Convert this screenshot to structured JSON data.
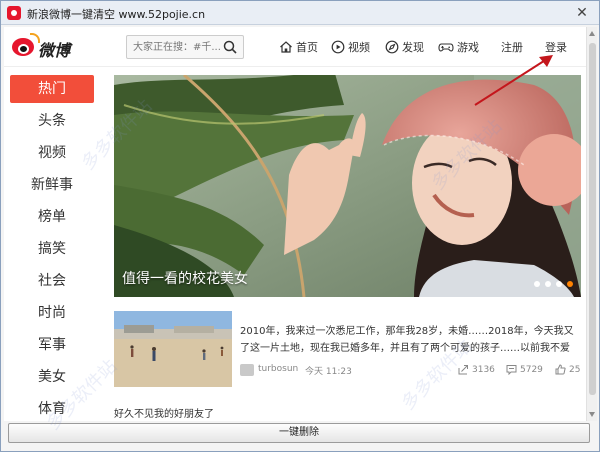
{
  "window": {
    "title": "新浪微博一键清空 www.52pojie.cn",
    "close_symbol": "✕"
  },
  "header": {
    "logo_text": "微博",
    "search_placeholder": "大家正在搜：#千...",
    "nav": {
      "home": "首页",
      "video": "视频",
      "discover": "发现",
      "game": "游戏",
      "register": "注册",
      "login": "登录"
    }
  },
  "sidebar": {
    "items": [
      {
        "label": "热门",
        "active": true
      },
      {
        "label": "头条"
      },
      {
        "label": "视频"
      },
      {
        "label": "新鲜事"
      },
      {
        "label": "榜单"
      },
      {
        "label": "搞笑"
      },
      {
        "label": "社会"
      },
      {
        "label": "时尚"
      },
      {
        "label": "军事"
      },
      {
        "label": "美女"
      },
      {
        "label": "体育"
      }
    ]
  },
  "banner": {
    "caption": "值得一看的校花美女",
    "slide_count": 4,
    "active_slide": 4,
    "colors": {
      "active_dot": "#ff8200"
    }
  },
  "feed": {
    "item": {
      "lines": [
        "2010年，我来过一次悉尼工作，那年我28岁，未婚……2018年，今天我又",
        "了这一片土地，现在我已婚多年，并且有了两个可爱的孩子……以前我不爱"
      ],
      "user": "turbosun",
      "time": "今天 11:23",
      "shares": "3136",
      "comments": "5729",
      "likes": "25"
    },
    "second_item_text": "好久不见我的好朋友了"
  },
  "footer": {
    "clear_button": "一键删除"
  },
  "watermark": "多多软件站",
  "colors": {
    "brand_red": "#e6162d",
    "active_tab": "#f24e3a",
    "arrow": "#c4161c"
  }
}
